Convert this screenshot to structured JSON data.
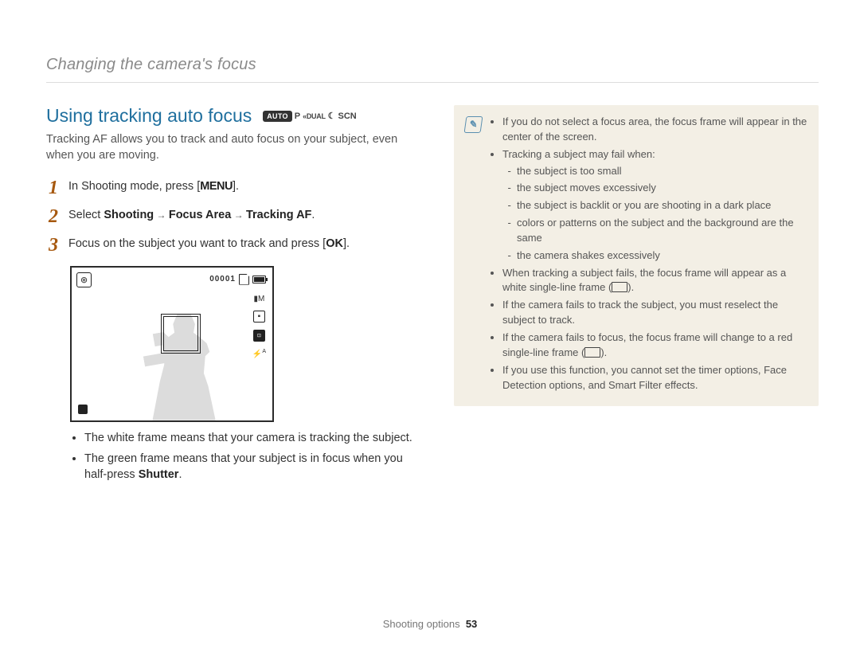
{
  "breadcrumb": "Changing the camera's focus",
  "section_title": "Using tracking auto focus",
  "mode_icons": {
    "auto": "AUTO",
    "p": "P",
    "dual": "DUAL",
    "scn": "SCN"
  },
  "intro": "Tracking AF allows you to track and auto focus on your subject, even when you are moving.",
  "steps": {
    "s1a": "In Shooting mode, press [",
    "s1b": "MENU",
    "s1c": "].",
    "s2a": "Select ",
    "s2b": "Shooting",
    "s2arrow": " → ",
    "s2c": "Focus Area",
    "s2d": "Tracking AF",
    "s2e": ".",
    "s3a": "Focus on the subject you want to track and press [",
    "s3b": "OK",
    "s3c": "]."
  },
  "viewfinder": {
    "counter": "00001",
    "res": "M",
    "flash": "A"
  },
  "post_bullets": [
    "The white frame means that your camera is tracking the subject.",
    "The green frame means that your subject is in focus when you half-press "
  ],
  "shutter_label": "Shutter",
  "notes": {
    "n1": "If you do not select a focus area, the focus frame will appear in the center of the screen.",
    "n2": "Tracking a subject may fail when:",
    "n2a": "the subject is too small",
    "n2b": "the subject moves excessively",
    "n2c": "the subject is backlit or you are shooting in a dark place",
    "n2d": "colors or patterns on the subject and the background are the same",
    "n2e": "the camera shakes excessively",
    "n3a": "When tracking a subject fails, the focus frame will appear as a white single-line frame (",
    "n3b": ").",
    "n4": "If the camera fails to track the subject, you must reselect the subject to track.",
    "n5a": "If the camera fails to focus, the focus frame will change to a red single-line frame (",
    "n5b": ").",
    "n6": "If you use this function, you cannot set the timer options, Face Detection options, and Smart Filter effects."
  },
  "footer": {
    "section": "Shooting options",
    "page": "53"
  }
}
